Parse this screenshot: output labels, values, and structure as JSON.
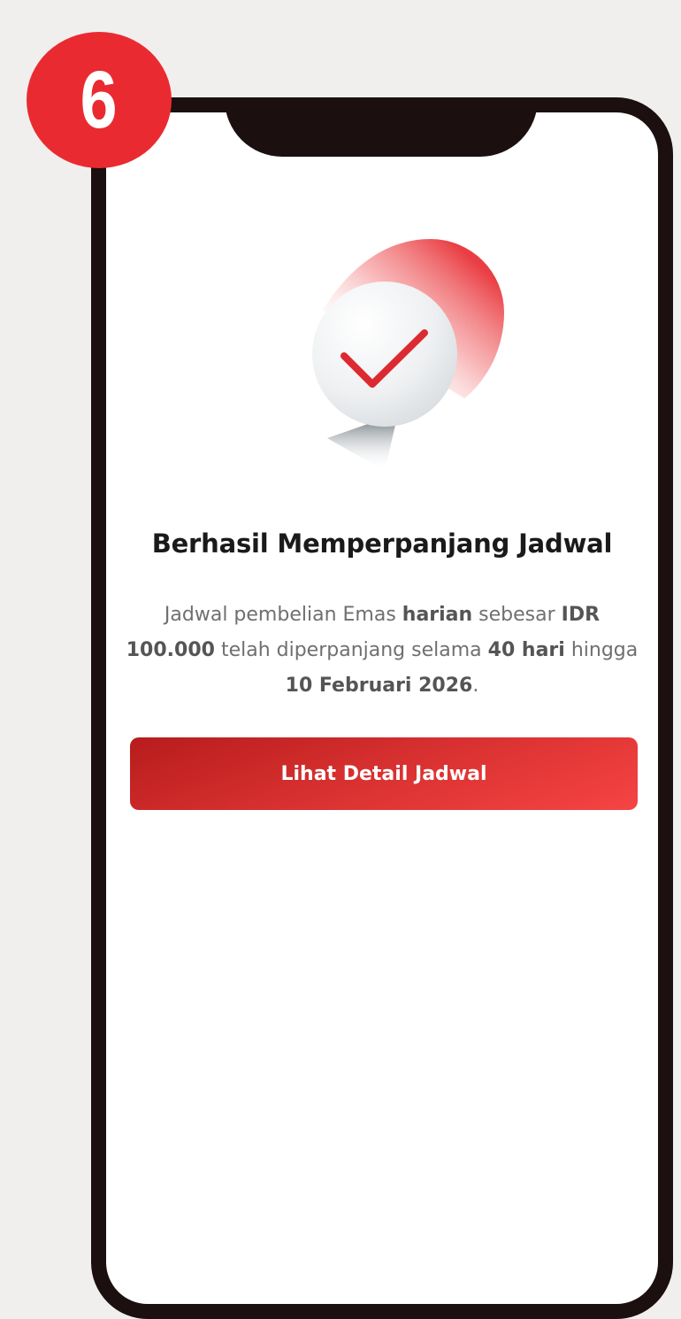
{
  "step": {
    "number": "6"
  },
  "result": {
    "icon": "success-check-icon",
    "title": "Berhasil Memperpanjang Jadwal",
    "description": {
      "t1": "Jadwal pembelian Emas ",
      "frequency": "harian",
      "t2": " sebesar ",
      "amount": "IDR 100.000",
      "t3": " telah diperpanjang selama ",
      "duration": "40 hari",
      "t4": " hingga ",
      "end_date": "10 Februari 2026",
      "t5": "."
    }
  },
  "actions": {
    "view_detail_label": "Lihat Detail Jadwal"
  },
  "colors": {
    "accent": "#ea2a31",
    "frame": "#1c0f0f",
    "background": "#f0efee",
    "button_start": "#b71c1c",
    "button_end": "#f54443"
  }
}
